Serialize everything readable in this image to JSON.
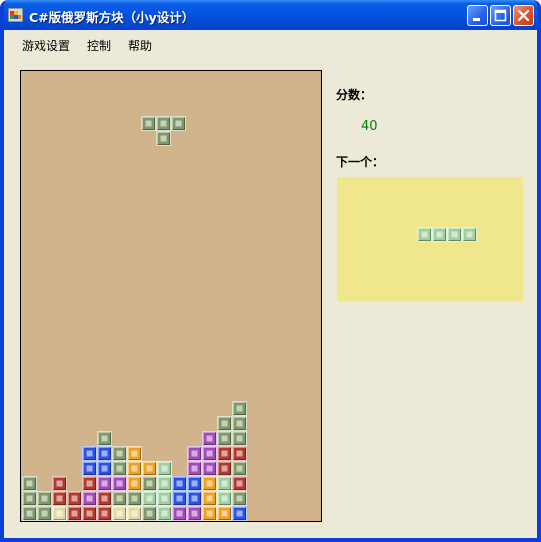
{
  "window": {
    "title": "C#版俄罗斯方块（小y设计）",
    "icons": {
      "app": "tetris-app-icon",
      "minimize": "minimize-icon",
      "maximize": "maximize-icon",
      "close": "close-icon"
    }
  },
  "menu": {
    "items": [
      "游戏设置",
      "控制",
      "帮助"
    ]
  },
  "sidepanel": {
    "score_label": "分数：",
    "score_value": "40",
    "next_label": "下一个："
  },
  "colors": {
    "board_bg": "#d2b48c",
    "preview_bg": "#f0e68c",
    "score": "#008000",
    "blocks": {
      "O": "#7f9868",
      "R": "#b03a2e",
      "B": "#2a52e8",
      "P": "#a04bb8",
      "Y": "#f0a020",
      "L": "#9fcf9f",
      "C": "#e4d9a0"
    }
  },
  "game": {
    "cols": 15,
    "rows": 22,
    "current_piece": {
      "type": "T",
      "color": "O",
      "cells": [
        [
          6,
          2
        ],
        [
          7,
          2
        ],
        [
          8,
          2
        ],
        [
          7,
          3
        ]
      ]
    },
    "next_piece": {
      "type": "I",
      "color": "L",
      "cells": [
        [
          0,
          0
        ],
        [
          1,
          0
        ],
        [
          2,
          0
        ],
        [
          3,
          0
        ]
      ]
    },
    "stack": [
      [
        14,
        16,
        "O"
      ],
      [
        14,
        17,
        "O"
      ],
      [
        13,
        17,
        "O"
      ],
      [
        5,
        18,
        "O"
      ],
      [
        13,
        18,
        "O"
      ],
      [
        12,
        18,
        "P"
      ],
      [
        14,
        18,
        "O"
      ],
      [
        4,
        19,
        "B"
      ],
      [
        5,
        19,
        "B"
      ],
      [
        6,
        19,
        "O"
      ],
      [
        7,
        19,
        "Y"
      ],
      [
        11,
        19,
        "P"
      ],
      [
        12,
        19,
        "P"
      ],
      [
        13,
        19,
        "R"
      ],
      [
        14,
        19,
        "R"
      ],
      [
        4,
        20,
        "B"
      ],
      [
        5,
        20,
        "B"
      ],
      [
        6,
        20,
        "O"
      ],
      [
        7,
        20,
        "Y"
      ],
      [
        8,
        20,
        "Y"
      ],
      [
        9,
        20,
        "L"
      ],
      [
        11,
        20,
        "P"
      ],
      [
        12,
        20,
        "P"
      ],
      [
        13,
        20,
        "R"
      ],
      [
        14,
        20,
        "O"
      ],
      [
        0,
        21,
        "O"
      ],
      [
        2,
        21,
        "R"
      ],
      [
        4,
        21,
        "R"
      ],
      [
        5,
        21,
        "P"
      ],
      [
        6,
        21,
        "P"
      ],
      [
        7,
        21,
        "Y"
      ],
      [
        8,
        21,
        "O"
      ],
      [
        9,
        21,
        "L"
      ],
      [
        10,
        21,
        "B"
      ],
      [
        11,
        21,
        "B"
      ],
      [
        12,
        21,
        "Y"
      ],
      [
        13,
        21,
        "L"
      ],
      [
        14,
        21,
        "R"
      ],
      [
        0,
        22,
        "O"
      ],
      [
        1,
        22,
        "O"
      ],
      [
        2,
        22,
        "R"
      ],
      [
        3,
        22,
        "R"
      ],
      [
        4,
        22,
        "P"
      ],
      [
        5,
        22,
        "R"
      ],
      [
        6,
        22,
        "O"
      ],
      [
        7,
        22,
        "O"
      ],
      [
        8,
        22,
        "L"
      ],
      [
        9,
        22,
        "L"
      ],
      [
        10,
        22,
        "B"
      ],
      [
        11,
        22,
        "B"
      ],
      [
        12,
        22,
        "Y"
      ],
      [
        13,
        22,
        "L"
      ],
      [
        14,
        22,
        "O"
      ],
      [
        0,
        23,
        "O"
      ],
      [
        1,
        23,
        "O"
      ],
      [
        2,
        23,
        "C"
      ],
      [
        3,
        23,
        "R"
      ],
      [
        4,
        23,
        "R"
      ],
      [
        5,
        23,
        "R"
      ],
      [
        6,
        23,
        "C"
      ],
      [
        7,
        23,
        "C"
      ],
      [
        8,
        23,
        "O"
      ],
      [
        9,
        23,
        "L"
      ],
      [
        10,
        23,
        "P"
      ],
      [
        11,
        23,
        "P"
      ],
      [
        12,
        23,
        "Y"
      ],
      [
        13,
        23,
        "Y"
      ],
      [
        14,
        23,
        "O"
      ],
      [
        15,
        23,
        "B"
      ]
    ]
  }
}
